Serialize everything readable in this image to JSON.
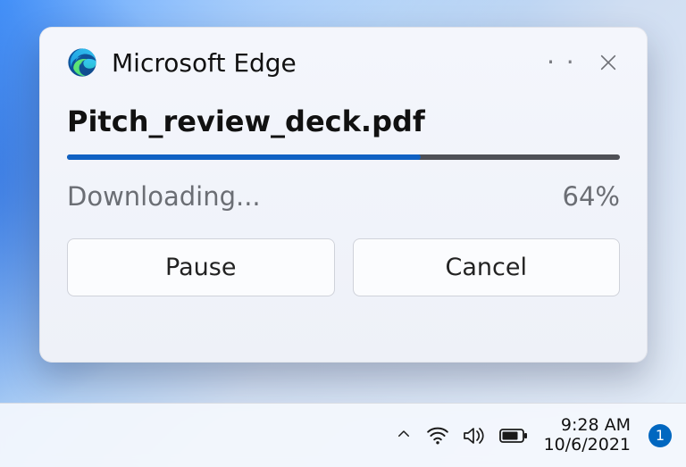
{
  "toast": {
    "app_name": "Microsoft Edge",
    "filename": "Pitch_review_deck.pdf",
    "status_text": "Downloading...",
    "progress_percent": 64,
    "progress_label": "64%",
    "pause_label": "Pause",
    "cancel_label": "Cancel",
    "more_label": "· · ·"
  },
  "taskbar": {
    "time": "9:28 AM",
    "date": "10/6/2021",
    "notification_count": "1"
  },
  "colors": {
    "accent": "#0067c0",
    "progress_fill": "#1061c3"
  }
}
